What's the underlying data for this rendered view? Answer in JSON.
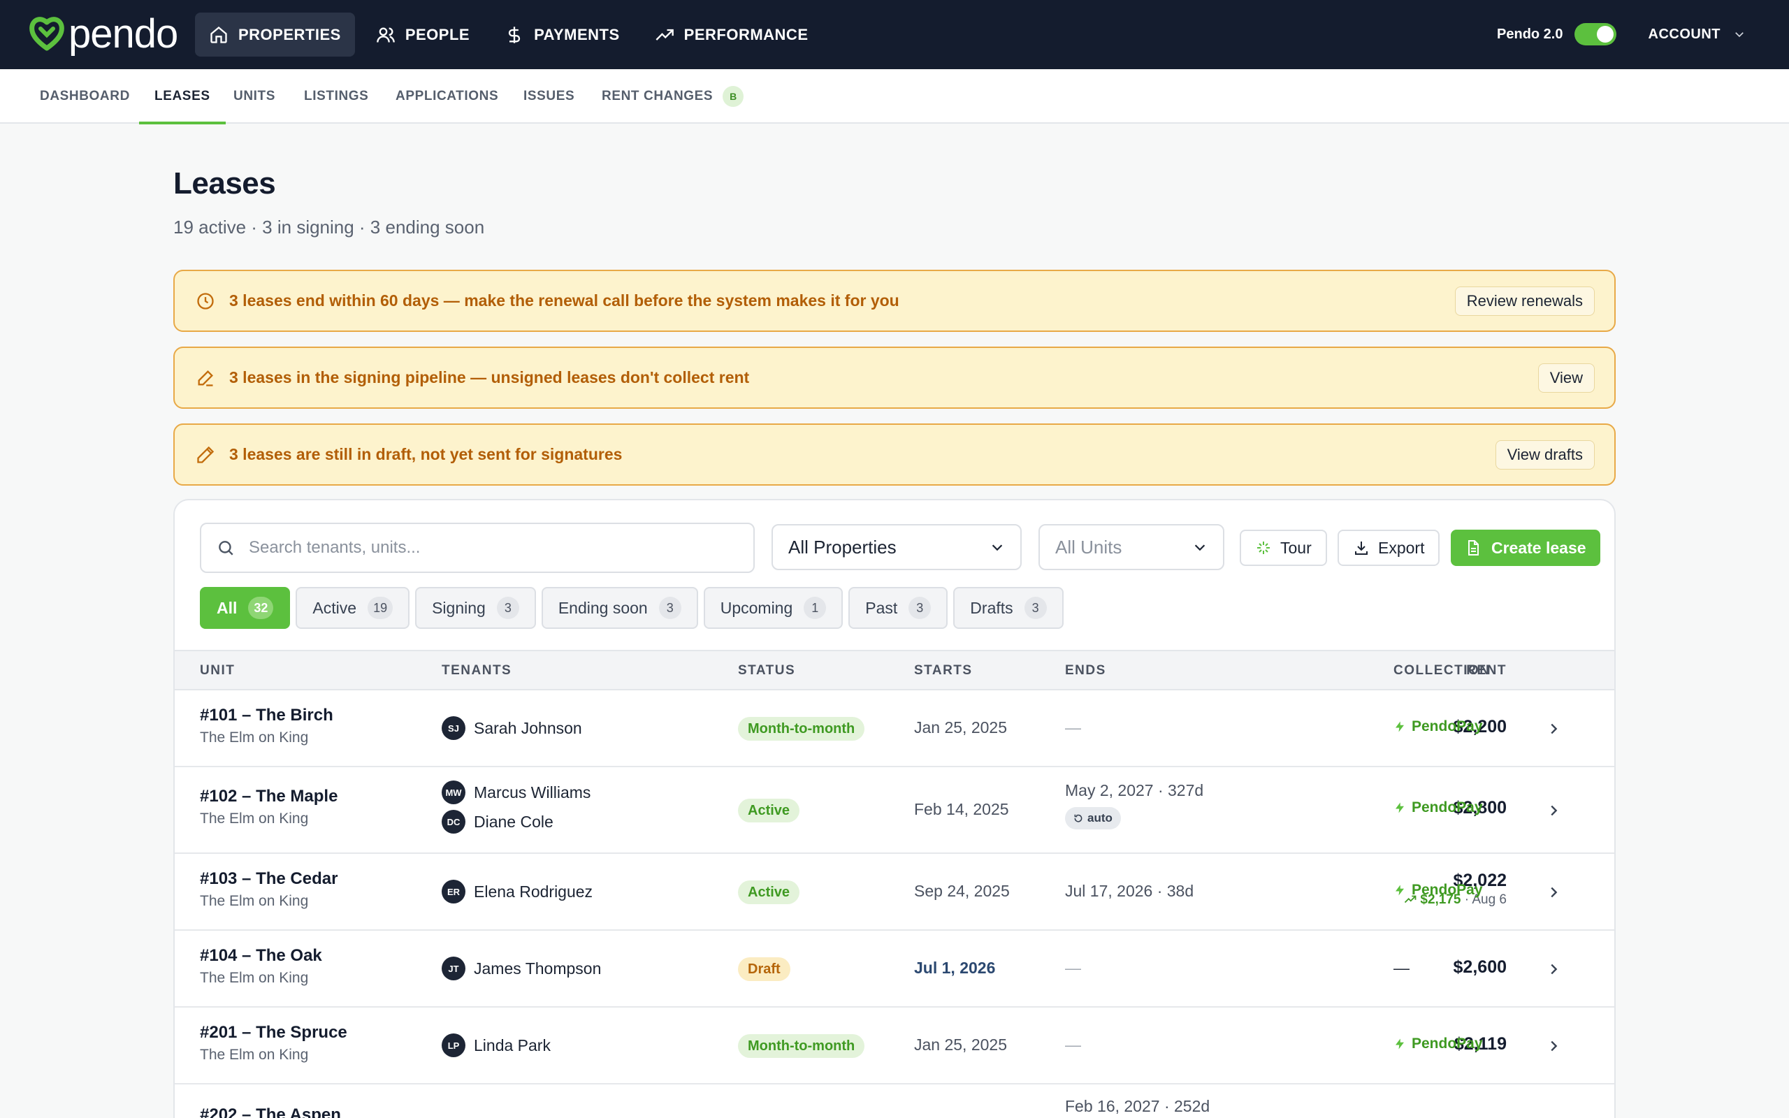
{
  "brand": {
    "name": "pendo",
    "accent": "#5cc03e",
    "nav_bg": "#141c2e"
  },
  "topnav": {
    "items": [
      {
        "label": "PROPERTIES",
        "icon": "home-icon"
      },
      {
        "label": "PEOPLE",
        "icon": "people-icon"
      },
      {
        "label": "PAYMENTS",
        "icon": "dollar-icon"
      },
      {
        "label": "PERFORMANCE",
        "icon": "trend-up-icon"
      }
    ],
    "version_label": "Pendo 2.0",
    "account_label": "ACCOUNT"
  },
  "subnav": {
    "tabs": [
      "DASHBOARD",
      "LEASES",
      "UNITS",
      "LISTINGS",
      "APPLICATIONS",
      "ISSUES",
      "RENT CHANGES"
    ],
    "active": "LEASES",
    "beta_badge": "B"
  },
  "page": {
    "title": "Leases",
    "subtitle": "19 active · 3 in signing · 3 ending soon"
  },
  "banners": [
    {
      "icon": "clock-icon",
      "text": "3 leases end within 60 days — make the renewal call before the system makes it for you",
      "button": "Review renewals"
    },
    {
      "icon": "signature-icon",
      "text": "3 leases in the signing pipeline — unsigned leases don't collect rent",
      "button": "View"
    },
    {
      "icon": "pencil-icon",
      "text": "3 leases are still in draft, not yet sent for signatures",
      "button": "View drafts"
    }
  ],
  "toolbar": {
    "search_placeholder": "Search tenants, units...",
    "property_select": "All Properties",
    "unit_select": "All Units",
    "tour_label": "Tour",
    "export_label": "Export",
    "create_label": "Create lease"
  },
  "filters": [
    {
      "label": "All",
      "count": "32",
      "active": true
    },
    {
      "label": "Active",
      "count": "19"
    },
    {
      "label": "Signing",
      "count": "3"
    },
    {
      "label": "Ending soon",
      "count": "3"
    },
    {
      "label": "Upcoming",
      "count": "1"
    },
    {
      "label": "Past",
      "count": "3"
    },
    {
      "label": "Drafts",
      "count": "3"
    }
  ],
  "table": {
    "columns": {
      "unit": "UNIT",
      "tenants": "TENANTS",
      "status": "STATUS",
      "starts": "STARTS",
      "ends": "ENDS",
      "rent": "RENT",
      "collection": "COLLECTION"
    },
    "rows": [
      {
        "unit": "#101 – The Birch",
        "property": "The Elm on King",
        "t1_initials": "SJ",
        "t1_name": "Sarah Johnson",
        "status": "Month-to-month",
        "starts": "Jan 25, 2025",
        "ends": "—",
        "rent": "$2,200",
        "collection": "PendoPay"
      },
      {
        "unit": "#102 – The Maple",
        "property": "The Elm on King",
        "t1_initials": "MW",
        "t1_name": "Marcus Williams",
        "t2_initials": "DC",
        "t2_name": "Diane Cole",
        "status": "Active",
        "starts": "Feb 14, 2025",
        "ends": "May 2, 2027 · 327d",
        "ends_badge": "auto",
        "rent": "$2,800",
        "collection": "PendoPay"
      },
      {
        "unit": "#103 – The Cedar",
        "property": "The Elm on King",
        "t1_initials": "ER",
        "t1_name": "Elena Rodriguez",
        "status": "Active",
        "starts": "Sep 24, 2025",
        "ends": "Jul 17, 2026 · 38d",
        "rent": "$2,022",
        "rent_change": "$2,175",
        "rent_change_date": "· Aug 6",
        "collection": "PendoPay"
      },
      {
        "unit": "#104 – The Oak",
        "property": "The Elm on King",
        "t1_initials": "JT",
        "t1_name": "James Thompson",
        "status": "Draft",
        "starts": "Jul 1, 2026",
        "ends": "—",
        "rent": "$2,600",
        "collection": "—"
      },
      {
        "unit": "#201 – The Spruce",
        "property": "The Elm on King",
        "t1_initials": "LP",
        "t1_name": "Linda Park",
        "status": "Month-to-month",
        "starts": "Jan 25, 2025",
        "ends": "—",
        "rent": "$2,119",
        "collection": "PendoPay"
      },
      {
        "unit": "#202 – The Aspen",
        "ends": "Feb 16, 2027 · 252d"
      }
    ]
  }
}
